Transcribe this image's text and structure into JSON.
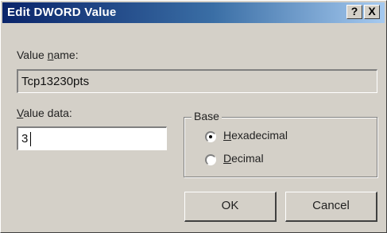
{
  "window": {
    "title": "Edit DWORD Value",
    "help_label": "?",
    "close_label": "X"
  },
  "value_name": {
    "label_pre": "Value ",
    "label_accel": "n",
    "label_post": "ame:",
    "value": "Tcp13230pts"
  },
  "value_data": {
    "label_accel": "V",
    "label_post": "alue data:",
    "value": "3"
  },
  "base": {
    "title": "Base",
    "options": [
      {
        "accel": "H",
        "rest": "exadecimal",
        "selected": true
      },
      {
        "accel": "D",
        "rest": "ecimal",
        "selected": false
      }
    ]
  },
  "buttons": {
    "ok": "OK",
    "cancel": "Cancel"
  }
}
